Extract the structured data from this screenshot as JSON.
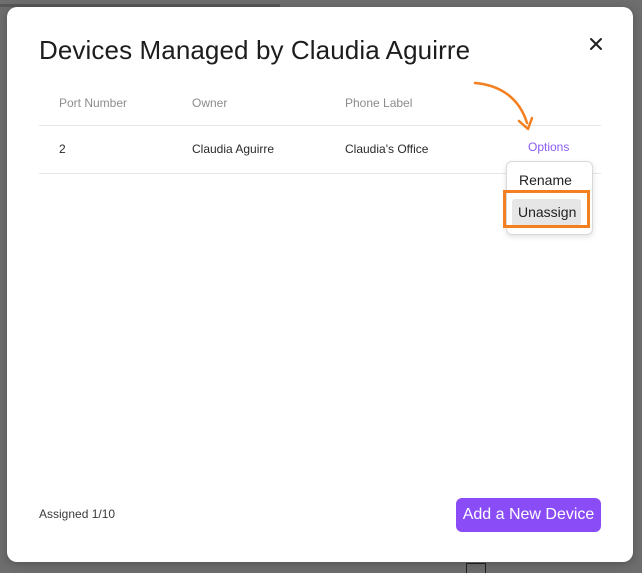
{
  "modal": {
    "title": "Devices Managed by Claudia Aguirre",
    "close_icon": "close-icon"
  },
  "table": {
    "headers": [
      "Port Number",
      "Owner",
      "Phone Label"
    ],
    "rows": [
      {
        "port_number": "2",
        "owner": "Claudia Aguirre",
        "phone_label": "Claudia's Office",
        "options_label": "Options"
      }
    ]
  },
  "options_menu": {
    "items": [
      "Rename",
      "Unassign"
    ],
    "highlighted_item": "Unassign"
  },
  "annotation": {
    "arrow_icon": "curved-arrow-icon",
    "color": "#f47f1f"
  },
  "footer": {
    "assigned_text": "Assigned 1/10",
    "add_button_label": "Add a New Device"
  },
  "colors": {
    "accent": "#8a4cf7",
    "link": "#8a5cf5",
    "overlay": "#6b6b6b"
  }
}
